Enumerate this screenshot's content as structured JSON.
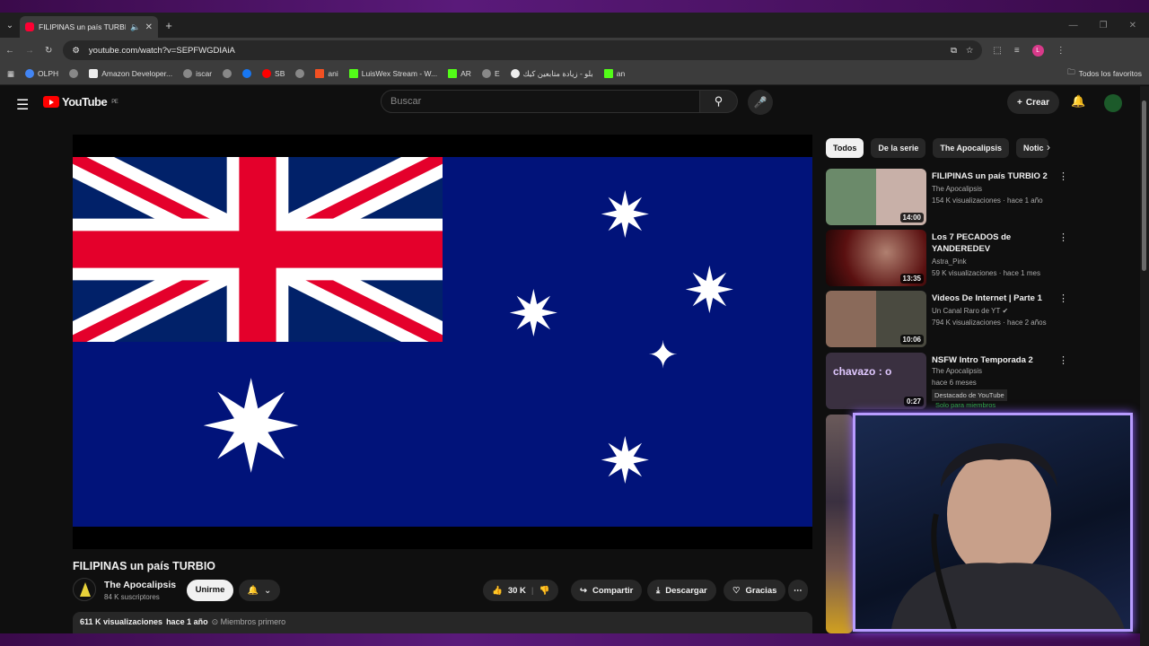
{
  "browser": {
    "tab_title": "FILIPINAS un país TURBIO -",
    "url": "youtube.com/watch?v=SEPFWGDIAiA",
    "bookmarks": [
      "OLPH",
      "Amazon Developer...",
      "iscar",
      "",
      "SB",
      "ani",
      "LuisWex Stream - W...",
      "AR",
      "E",
      "بلو - زيادة متابعين كيك",
      "an"
    ],
    "all_bookmarks": "Todos los favoritos",
    "profile_initial": "L"
  },
  "youtube": {
    "logo_text": "YouTube",
    "country_code": "PE",
    "search_placeholder": "Buscar",
    "create_label": "Crear"
  },
  "video": {
    "title": "FILIPINAS un país TURBIO",
    "channel": "The Apocalipsis",
    "subscribers": "84 K suscriptores",
    "join_label": "Unirme",
    "likes": "30 K",
    "share_label": "Compartir",
    "download_label": "Descargar",
    "thanks_label": "Gracias",
    "views": "611 K visualizaciones",
    "age": "hace 1 año",
    "members_first": "Miembros primero"
  },
  "chips": [
    "Todos",
    "De la serie",
    "The Apocalipsis",
    "Notic"
  ],
  "recommendations": [
    {
      "title": "FILIPINAS un país TURBIO 2",
      "channel": "The Apocalipsis",
      "meta": "154 K visualizaciones · hace 1 año",
      "duration": "14:00",
      "thumb_color": "#6b8a6a"
    },
    {
      "title": "Los 7 PECADOS de YANDEREDEV",
      "channel": "Astra_Pink",
      "meta": "59 K visualizaciones · hace 1 mes",
      "duration": "13:35",
      "thumb_color": "#5a1010"
    },
    {
      "title": "Videos De Internet | Parte 1",
      "channel": "Un Canal Raro de YT",
      "meta": "794 K visualizaciones · hace 2 años",
      "duration": "10:06",
      "thumb_color": "#8a6a5a"
    },
    {
      "title": "NSFW Intro Temporada 2",
      "channel": "The Apocalipsis",
      "meta": "hace 6 meses",
      "duration": "0:27",
      "thumb_color": "#3a3040",
      "thumb_text": "chavazo : o",
      "badge": "Destacado de YouTube",
      "members_only": "Solo para miembros"
    }
  ],
  "colors": {
    "flag_blue": "#01137a",
    "flag_red": "#e4002b",
    "yt_red": "#ff0000",
    "cam_border": "#b89cff"
  }
}
